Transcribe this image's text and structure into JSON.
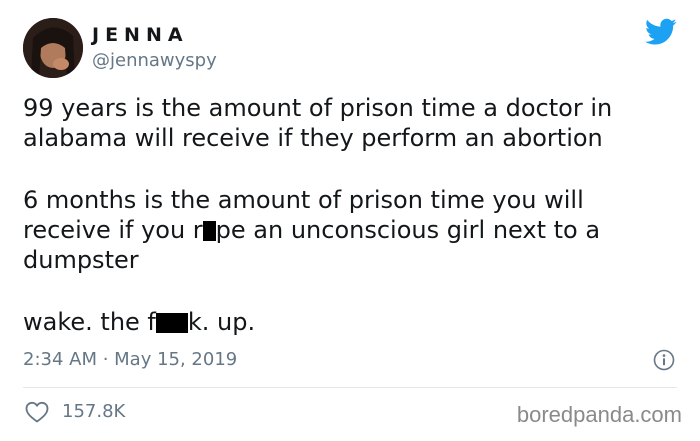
{
  "tweet": {
    "display_name": "JENNA",
    "handle": "@jennawyspy",
    "paragraph1": {
      "line1": "99 years is the amount of prison time a doctor in",
      "line2": "alabama will receive if they perform an abortion"
    },
    "paragraph2": {
      "line1": "6 months is the amount of prison time you will",
      "line2_a": "receive if you r",
      "line2_b": "pe an unconscious girl next to a",
      "line3": "dumpster"
    },
    "paragraph3": {
      "part_a": "wake. the f",
      "part_b": "k. up."
    },
    "timestamp": "2:34 AM · May 15, 2019",
    "likes": "157.8K"
  },
  "icons": {
    "brand": "twitter-bird-icon",
    "info": "info-icon",
    "like": "heart-icon"
  },
  "colors": {
    "twitter_blue": "#1da1f2",
    "text": "#14171a",
    "muted": "#657786",
    "divider": "#e1e8ed",
    "watermark": "#8a8a8a"
  },
  "watermark": "boredpanda.com"
}
